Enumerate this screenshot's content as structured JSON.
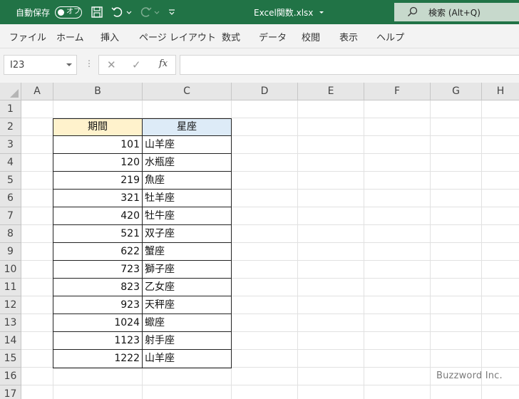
{
  "titlebar": {
    "autosave_label": "自動保存",
    "autosave_state": "オフ",
    "filename": "Excel関数.xlsx",
    "search_placeholder": "検索 (Alt+Q)",
    "bg_color": "#217346"
  },
  "ribbon": {
    "tabs": [
      "ファイル",
      "ホーム",
      "挿入",
      "ページ レイアウト",
      "数式",
      "データ",
      "校閲",
      "表示",
      "ヘルプ"
    ]
  },
  "formula_bar": {
    "name_box": "I23",
    "formula": ""
  },
  "sheet": {
    "columns": [
      "A",
      "B",
      "C",
      "D",
      "E",
      "F",
      "G",
      "H"
    ],
    "rows": [
      "1",
      "2",
      "3",
      "4",
      "5",
      "6",
      "7",
      "8",
      "9",
      "10",
      "11",
      "12",
      "13",
      "14",
      "15",
      "16",
      "17"
    ],
    "headers": {
      "period": "期間",
      "constellation": "星座"
    },
    "header_colors": {
      "period": "#fff2cc",
      "constellation": "#ddebf7"
    },
    "data": [
      {
        "period": "101",
        "constellation": "山羊座"
      },
      {
        "period": "120",
        "constellation": "水瓶座"
      },
      {
        "period": "219",
        "constellation": "魚座"
      },
      {
        "period": "321",
        "constellation": "牡羊座"
      },
      {
        "period": "420",
        "constellation": "牡牛座"
      },
      {
        "period": "521",
        "constellation": "双子座"
      },
      {
        "period": "622",
        "constellation": "蟹座"
      },
      {
        "period": "723",
        "constellation": "獅子座"
      },
      {
        "period": "823",
        "constellation": "乙女座"
      },
      {
        "period": "923",
        "constellation": "天秤座"
      },
      {
        "period": "1024",
        "constellation": "蠍座"
      },
      {
        "period": "1123",
        "constellation": "射手座"
      },
      {
        "period": "1222",
        "constellation": "山羊座"
      }
    ]
  },
  "watermark": "Buzzword Inc."
}
